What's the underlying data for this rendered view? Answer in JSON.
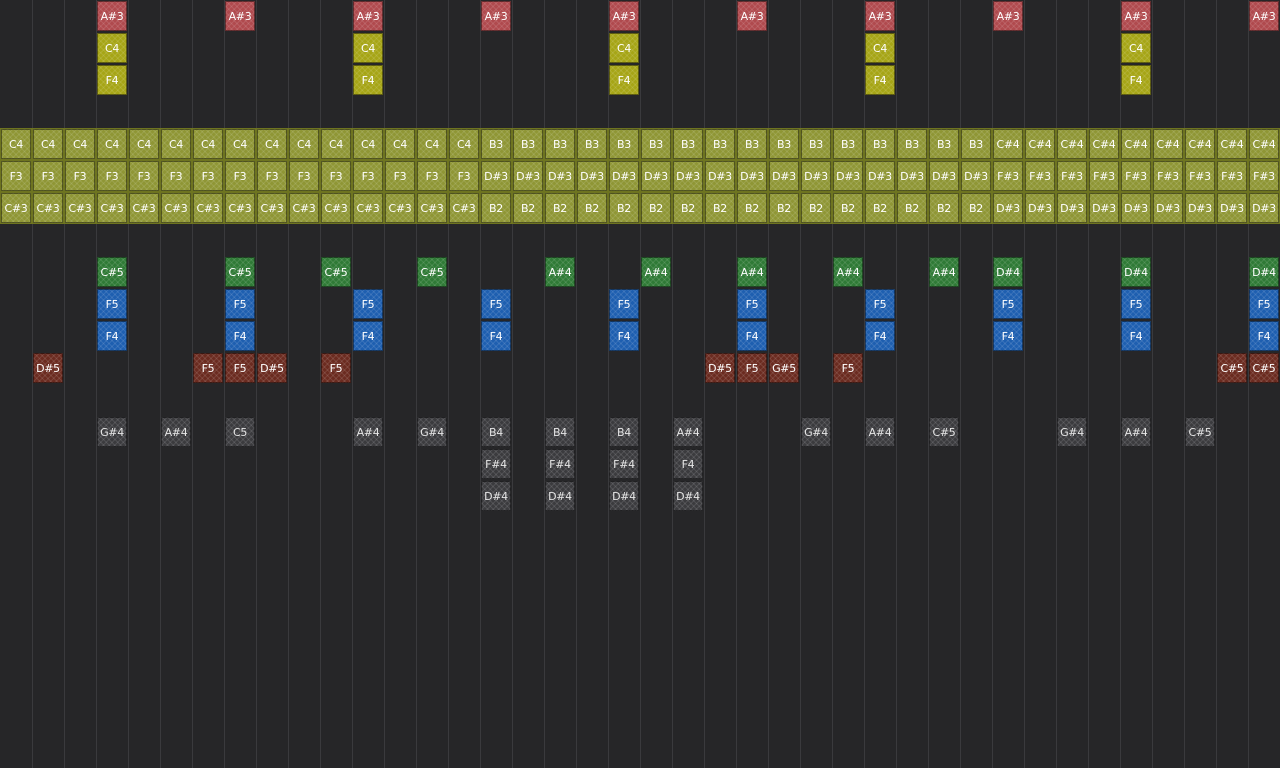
{
  "colors": {
    "background": "#262628",
    "gridline": "#3a3a3d",
    "red": "#b04a4e",
    "yellow": "#a6a516",
    "olive": "#8f9635",
    "green": "#2f7a36",
    "blue": "#1e5fb0",
    "maroon": "#6b2b20",
    "gray": "#3b3b3e"
  },
  "grid": {
    "columns": 40
  },
  "chord_rows": [
    {
      "name": "top",
      "notes": [
        "C4",
        "C4",
        "C4",
        "C4",
        "C4",
        "C4",
        "C4",
        "C4",
        "C4",
        "C4",
        "C4",
        "C4",
        "C4",
        "C4",
        "C4",
        "B3",
        "B3",
        "B3",
        "B3",
        "B3",
        "B3",
        "B3",
        "B3",
        "B3",
        "B3",
        "B3",
        "B3",
        "B3",
        "B3",
        "B3",
        "B3",
        "C#4",
        "C#4",
        "C#4",
        "C#4",
        "C#4",
        "C#4",
        "C#4",
        "C#4",
        "C#4"
      ]
    },
    {
      "name": "middle",
      "notes": [
        "F3",
        "F3",
        "F3",
        "F3",
        "F3",
        "F3",
        "F3",
        "F3",
        "F3",
        "F3",
        "F3",
        "F3",
        "F3",
        "F3",
        "F3",
        "D#3",
        "D#3",
        "D#3",
        "D#3",
        "D#3",
        "D#3",
        "D#3",
        "D#3",
        "D#3",
        "D#3",
        "D#3",
        "D#3",
        "D#3",
        "D#3",
        "D#3",
        "D#3",
        "F#3",
        "F#3",
        "F#3",
        "F#3",
        "F#3",
        "F#3",
        "F#3",
        "F#3",
        "F#3"
      ]
    },
    {
      "name": "bottom",
      "notes": [
        "C#3",
        "C#3",
        "C#3",
        "C#3",
        "C#3",
        "C#3",
        "C#3",
        "C#3",
        "C#3",
        "C#3",
        "C#3",
        "C#3",
        "C#3",
        "C#3",
        "C#3",
        "B2",
        "B2",
        "B2",
        "B2",
        "B2",
        "B2",
        "B2",
        "B2",
        "B2",
        "B2",
        "B2",
        "B2",
        "B2",
        "B2",
        "B2",
        "B2",
        "D#3",
        "D#3",
        "D#3",
        "D#3",
        "D#3",
        "D#3",
        "D#3",
        "D#3",
        "D#3"
      ]
    }
  ],
  "lane_notes": [
    {
      "col": 3,
      "row": 0,
      "label": "A#3",
      "color": "red"
    },
    {
      "col": 7,
      "row": 0,
      "label": "A#3",
      "color": "red"
    },
    {
      "col": 11,
      "row": 0,
      "label": "A#3",
      "color": "red"
    },
    {
      "col": 15,
      "row": 0,
      "label": "A#3",
      "color": "red"
    },
    {
      "col": 19,
      "row": 0,
      "label": "A#3",
      "color": "red"
    },
    {
      "col": 23,
      "row": 0,
      "label": "A#3",
      "color": "red"
    },
    {
      "col": 27,
      "row": 0,
      "label": "A#3",
      "color": "red"
    },
    {
      "col": 31,
      "row": 0,
      "label": "A#3",
      "color": "red"
    },
    {
      "col": 35,
      "row": 0,
      "label": "A#3",
      "color": "red"
    },
    {
      "col": 39,
      "row": 0,
      "label": "A#3",
      "color": "red"
    },
    {
      "col": 3,
      "row": 1,
      "label": "C4",
      "color": "yellow"
    },
    {
      "col": 11,
      "row": 1,
      "label": "C4",
      "color": "yellow"
    },
    {
      "col": 19,
      "row": 1,
      "label": "C4",
      "color": "yellow"
    },
    {
      "col": 27,
      "row": 1,
      "label": "C4",
      "color": "yellow"
    },
    {
      "col": 35,
      "row": 1,
      "label": "C4",
      "color": "yellow"
    },
    {
      "col": 3,
      "row": 2,
      "label": "F4",
      "color": "yellow"
    },
    {
      "col": 11,
      "row": 2,
      "label": "F4",
      "color": "yellow"
    },
    {
      "col": 19,
      "row": 2,
      "label": "F4",
      "color": "yellow"
    },
    {
      "col": 27,
      "row": 2,
      "label": "F4",
      "color": "yellow"
    },
    {
      "col": 35,
      "row": 2,
      "label": "F4",
      "color": "yellow"
    },
    {
      "col": 3,
      "row": 8,
      "label": "C#5",
      "color": "green"
    },
    {
      "col": 7,
      "row": 8,
      "label": "C#5",
      "color": "green"
    },
    {
      "col": 10,
      "row": 8,
      "label": "C#5",
      "color": "green"
    },
    {
      "col": 13,
      "row": 8,
      "label": "C#5",
      "color": "green"
    },
    {
      "col": 17,
      "row": 8,
      "label": "A#4",
      "color": "green"
    },
    {
      "col": 20,
      "row": 8,
      "label": "A#4",
      "color": "green"
    },
    {
      "col": 23,
      "row": 8,
      "label": "A#4",
      "color": "green"
    },
    {
      "col": 26,
      "row": 8,
      "label": "A#4",
      "color": "green"
    },
    {
      "col": 29,
      "row": 8,
      "label": "A#4",
      "color": "green"
    },
    {
      "col": 31,
      "row": 8,
      "label": "D#4",
      "color": "green"
    },
    {
      "col": 35,
      "row": 8,
      "label": "D#4",
      "color": "green"
    },
    {
      "col": 39,
      "row": 8,
      "label": "D#4",
      "color": "green"
    },
    {
      "col": 3,
      "row": 9,
      "label": "F5",
      "color": "blue"
    },
    {
      "col": 7,
      "row": 9,
      "label": "F5",
      "color": "blue"
    },
    {
      "col": 11,
      "row": 9,
      "label": "F5",
      "color": "blue"
    },
    {
      "col": 15,
      "row": 9,
      "label": "F5",
      "color": "blue"
    },
    {
      "col": 19,
      "row": 9,
      "label": "F5",
      "color": "blue"
    },
    {
      "col": 23,
      "row": 9,
      "label": "F5",
      "color": "blue"
    },
    {
      "col": 27,
      "row": 9,
      "label": "F5",
      "color": "blue"
    },
    {
      "col": 31,
      "row": 9,
      "label": "F5",
      "color": "blue"
    },
    {
      "col": 35,
      "row": 9,
      "label": "F5",
      "color": "blue"
    },
    {
      "col": 39,
      "row": 9,
      "label": "F5",
      "color": "blue"
    },
    {
      "col": 3,
      "row": 10,
      "label": "F4",
      "color": "blue"
    },
    {
      "col": 7,
      "row": 10,
      "label": "F4",
      "color": "blue"
    },
    {
      "col": 11,
      "row": 10,
      "label": "F4",
      "color": "blue"
    },
    {
      "col": 15,
      "row": 10,
      "label": "F4",
      "color": "blue"
    },
    {
      "col": 19,
      "row": 10,
      "label": "F4",
      "color": "blue"
    },
    {
      "col": 23,
      "row": 10,
      "label": "F4",
      "color": "blue"
    },
    {
      "col": 27,
      "row": 10,
      "label": "F4",
      "color": "blue"
    },
    {
      "col": 31,
      "row": 10,
      "label": "F4",
      "color": "blue"
    },
    {
      "col": 35,
      "row": 10,
      "label": "F4",
      "color": "blue"
    },
    {
      "col": 39,
      "row": 10,
      "label": "F4",
      "color": "blue"
    },
    {
      "col": 1,
      "row": 11,
      "label": "D#5",
      "color": "maroon"
    },
    {
      "col": 6,
      "row": 11,
      "label": "F5",
      "color": "maroon"
    },
    {
      "col": 7,
      "row": 11,
      "label": "F5",
      "color": "maroon"
    },
    {
      "col": 8,
      "row": 11,
      "label": "D#5",
      "color": "maroon"
    },
    {
      "col": 10,
      "row": 11,
      "label": "F5",
      "color": "maroon"
    },
    {
      "col": 22,
      "row": 11,
      "label": "D#5",
      "color": "maroon"
    },
    {
      "col": 23,
      "row": 11,
      "label": "F5",
      "color": "maroon"
    },
    {
      "col": 24,
      "row": 11,
      "label": "G#5",
      "color": "maroon"
    },
    {
      "col": 26,
      "row": 11,
      "label": "F5",
      "color": "maroon"
    },
    {
      "col": 38,
      "row": 11,
      "label": "C#5",
      "color": "maroon"
    },
    {
      "col": 39,
      "row": 11,
      "label": "C#5",
      "color": "maroon"
    },
    {
      "col": 3,
      "row": 13,
      "label": "G#4",
      "color": "gray"
    },
    {
      "col": 5,
      "row": 13,
      "label": "A#4",
      "color": "gray"
    },
    {
      "col": 7,
      "row": 13,
      "label": "C5",
      "color": "gray"
    },
    {
      "col": 11,
      "row": 13,
      "label": "A#4",
      "color": "gray"
    },
    {
      "col": 13,
      "row": 13,
      "label": "G#4",
      "color": "gray"
    },
    {
      "col": 15,
      "row": 13,
      "label": "B4",
      "color": "gray"
    },
    {
      "col": 17,
      "row": 13,
      "label": "B4",
      "color": "gray"
    },
    {
      "col": 19,
      "row": 13,
      "label": "B4",
      "color": "gray"
    },
    {
      "col": 21,
      "row": 13,
      "label": "A#4",
      "color": "gray"
    },
    {
      "col": 25,
      "row": 13,
      "label": "G#4",
      "color": "gray"
    },
    {
      "col": 27,
      "row": 13,
      "label": "A#4",
      "color": "gray"
    },
    {
      "col": 29,
      "row": 13,
      "label": "C#5",
      "color": "gray"
    },
    {
      "col": 33,
      "row": 13,
      "label": "G#4",
      "color": "gray"
    },
    {
      "col": 35,
      "row": 13,
      "label": "A#4",
      "color": "gray"
    },
    {
      "col": 37,
      "row": 13,
      "label": "C#5",
      "color": "gray"
    },
    {
      "col": 15,
      "row": 14,
      "label": "F#4",
      "color": "gray"
    },
    {
      "col": 17,
      "row": 14,
      "label": "F#4",
      "color": "gray"
    },
    {
      "col": 19,
      "row": 14,
      "label": "F#4",
      "color": "gray"
    },
    {
      "col": 21,
      "row": 14,
      "label": "F4",
      "color": "gray"
    },
    {
      "col": 15,
      "row": 15,
      "label": "D#4",
      "color": "gray"
    },
    {
      "col": 17,
      "row": 15,
      "label": "D#4",
      "color": "gray"
    },
    {
      "col": 19,
      "row": 15,
      "label": "D#4",
      "color": "gray"
    },
    {
      "col": 21,
      "row": 15,
      "label": "D#4",
      "color": "gray"
    }
  ]
}
